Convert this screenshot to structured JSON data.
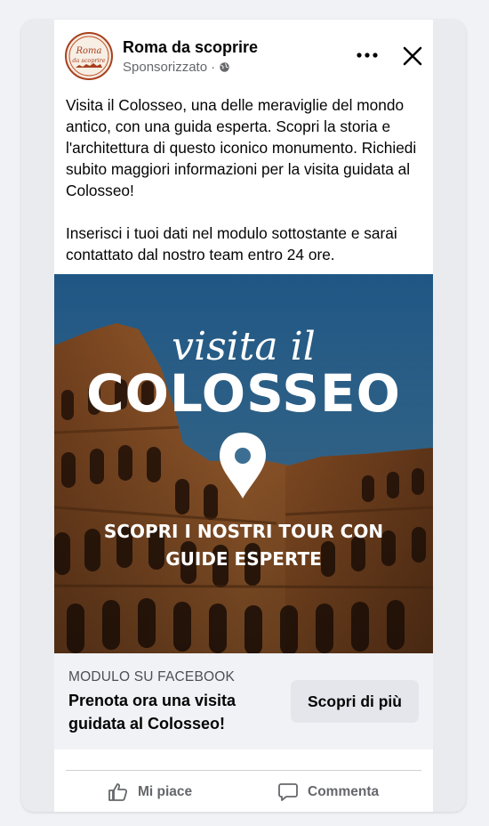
{
  "page": {
    "name": "Roma da scoprire",
    "sponsored": "Sponsorizzato",
    "separator": "·",
    "logo_text_top": "Roma",
    "logo_text_bottom": "da scoprire"
  },
  "post": {
    "paragraphs": [
      "Visita il Colosseo, una delle meraviglie del mondo antico, con una guida esperta. Scopri la storia e l'architettura di questo iconico monumento. Richiedi subito maggiori informazioni per la visita guidata al Colosseo!",
      "Inserisci i tuoi dati nel modulo sottostante e sarai contattato dal nostro team entro 24 ore."
    ]
  },
  "ad_image": {
    "script_line": "visita il",
    "title": "COLOSSEO",
    "tagline_line1": "SCOPRI I NOSTRI TOUR CON",
    "tagline_line2": "GUIDE ESPERTE"
  },
  "cta": {
    "caption": "MODULO SU FACEBOOK",
    "headline": "Prenota ora una visita guidata al Colosseo!",
    "button_label": "Scopri di più"
  },
  "actions": {
    "like": "Mi piace",
    "comment": "Commenta"
  },
  "icons": {
    "more": "more-horizontal-icon",
    "close": "close-icon",
    "globe": "globe-icon",
    "like": "thumbs-up-icon",
    "comment": "comment-icon",
    "pin": "map-pin-icon"
  },
  "colors": {
    "logo_ring": "#a8411f",
    "sky": "#2a5f88",
    "stone": "#9a5a2c",
    "cta_background": "#f0f2f5",
    "button_background": "#e4e6eb"
  }
}
